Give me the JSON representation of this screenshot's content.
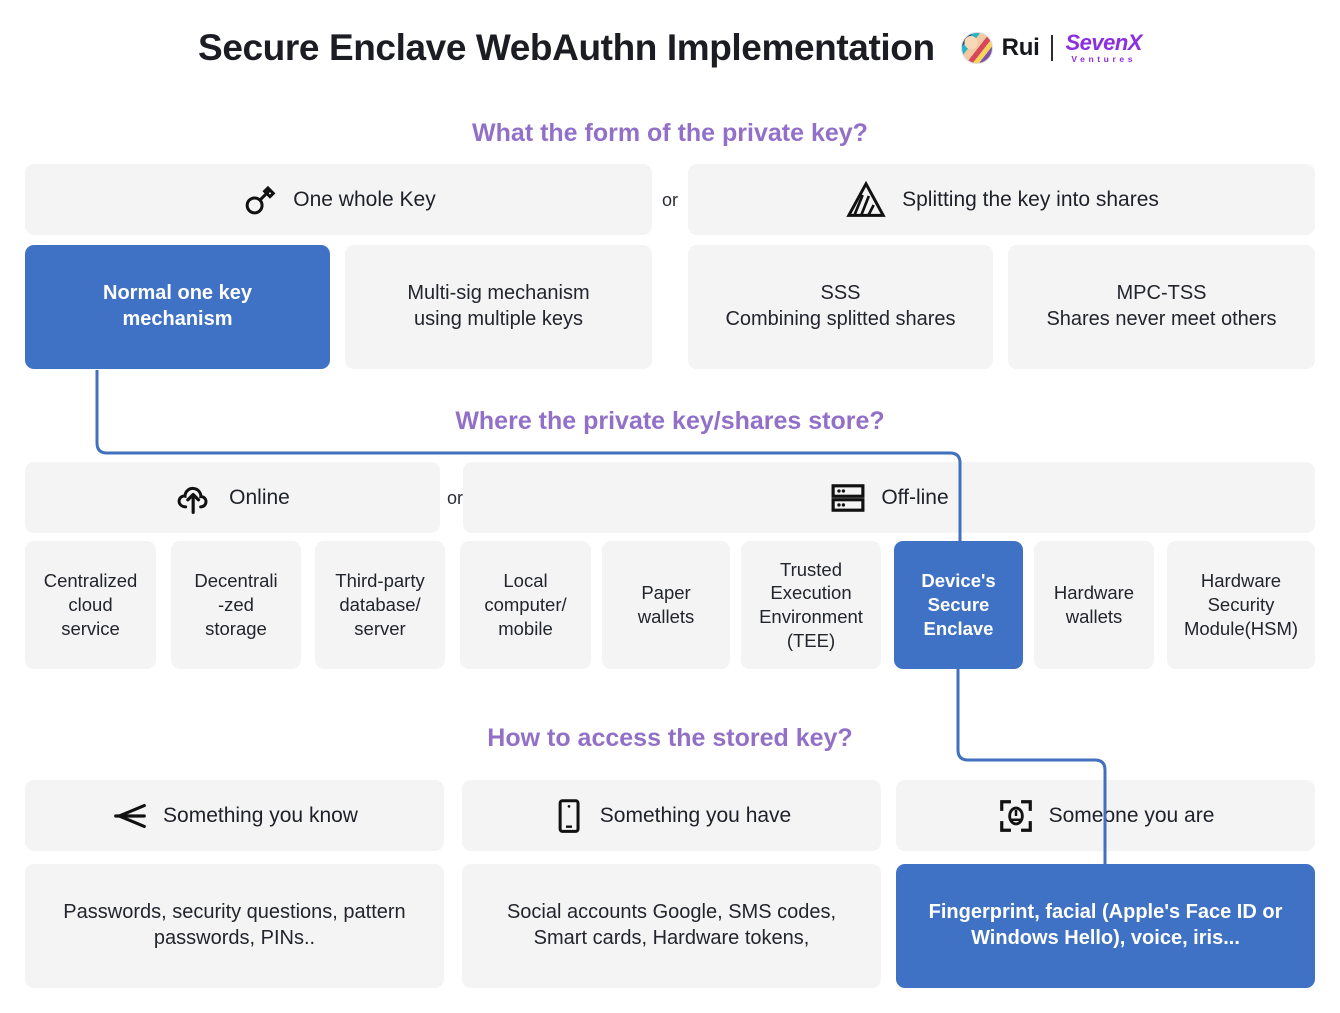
{
  "header": {
    "title": "Secure Enclave WebAuthn Implementation",
    "brand": {
      "avatar_icon": "avatar-portrait-icon",
      "name": "Rui",
      "partner_main": "SevenX",
      "partner_sub": "Ventures",
      "partner_color": "#8b2fe0"
    }
  },
  "theme": {
    "accent_purple": "#9370c8",
    "highlight_blue": "#3f72c4",
    "card_grey": "#f4f4f5",
    "connector_blue": "#4171bd"
  },
  "sections": [
    {
      "question": "What the form of the private key?",
      "or_label": "or",
      "banners": [
        {
          "icon": "key-icon",
          "label": "One whole Key"
        },
        {
          "icon": "split-shares-icon",
          "label": "Splitting the key into shares"
        }
      ],
      "options": [
        {
          "label": "Normal one key mechanism",
          "highlighted": true
        },
        {
          "label": "Multi-sig mechanism using multiple keys",
          "highlighted": false
        },
        {
          "label": "SSS\nCombining splitted shares",
          "highlighted": false
        },
        {
          "label": "MPC-TSS\nShares never meet others",
          "highlighted": false
        }
      ]
    },
    {
      "question": "Where the private key/shares store?",
      "or_label": "or",
      "banners": [
        {
          "icon": "cloud-upload-icon",
          "label": "Online"
        },
        {
          "icon": "server-rack-icon",
          "label": "Off-line"
        }
      ],
      "options": [
        {
          "label": "Centralized cloud service",
          "highlighted": false
        },
        {
          "label": "Decentrali -zed storage",
          "highlighted": false
        },
        {
          "label": "Third-party database/ server",
          "highlighted": false
        },
        {
          "label": "Local computer/ mobile",
          "highlighted": false
        },
        {
          "label": "Paper wallets",
          "highlighted": false
        },
        {
          "label": "Trusted Execution Environment (TEE)",
          "highlighted": false
        },
        {
          "label": "Device's Secure Enclave",
          "highlighted": true
        },
        {
          "label": "Hardware wallets",
          "highlighted": false
        },
        {
          "label": "Hardware Security Module(HSM)",
          "highlighted": false
        }
      ]
    },
    {
      "question": "How to access the stored key?",
      "banners": [
        {
          "icon": "brain-knowledge-icon",
          "label": "Something you know"
        },
        {
          "icon": "mobile-device-icon",
          "label": "Something you have"
        },
        {
          "icon": "face-scan-icon",
          "label": "Someone you are"
        }
      ],
      "options": [
        {
          "label": "Passwords, security questions, pattern passwords, PINs..",
          "highlighted": false
        },
        {
          "label": "Social accounts Google, SMS codes, Smart cards, Hardware tokens,",
          "highlighted": false
        },
        {
          "label": "Fingerprint, facial (Apple's Face ID or Windows Hello), voice, iris...",
          "highlighted": true
        }
      ]
    }
  ],
  "storage_lines": {
    "s0": [
      "Centralized",
      "cloud",
      "service"
    ],
    "s1": [
      "Decentrali",
      "-zed",
      "storage"
    ],
    "s2": [
      "Third-party",
      "database/",
      "server"
    ],
    "s3": [
      "Local",
      "computer/",
      "mobile"
    ],
    "s4": [
      "Paper",
      "wallets"
    ],
    "s5": [
      "Trusted",
      "Execution",
      "Environment",
      "(TEE)"
    ],
    "s6": [
      "Device's",
      "Secure",
      "Enclave"
    ],
    "s7": [
      "Hardware",
      "wallets"
    ],
    "s8": [
      "Hardware",
      "Security",
      "Module(HSM)"
    ]
  },
  "tier_lines": {
    "t0": [
      "Normal one key",
      "mechanism"
    ],
    "t1": [
      "Multi-sig mechanism",
      "using multiple keys"
    ],
    "t2": [
      "SSS",
      "Combining splitted shares"
    ],
    "t3": [
      "MPC-TSS",
      "Shares never meet others"
    ]
  },
  "access_lines": {
    "a0": [
      "Passwords, security questions, pattern",
      "passwords, PINs.."
    ],
    "a1": [
      "Social accounts Google, SMS codes,",
      "Smart cards, Hardware tokens,"
    ],
    "a2": [
      "Fingerprint, facial (Apple's Face ID or",
      "Windows Hello), voice, iris..."
    ]
  }
}
